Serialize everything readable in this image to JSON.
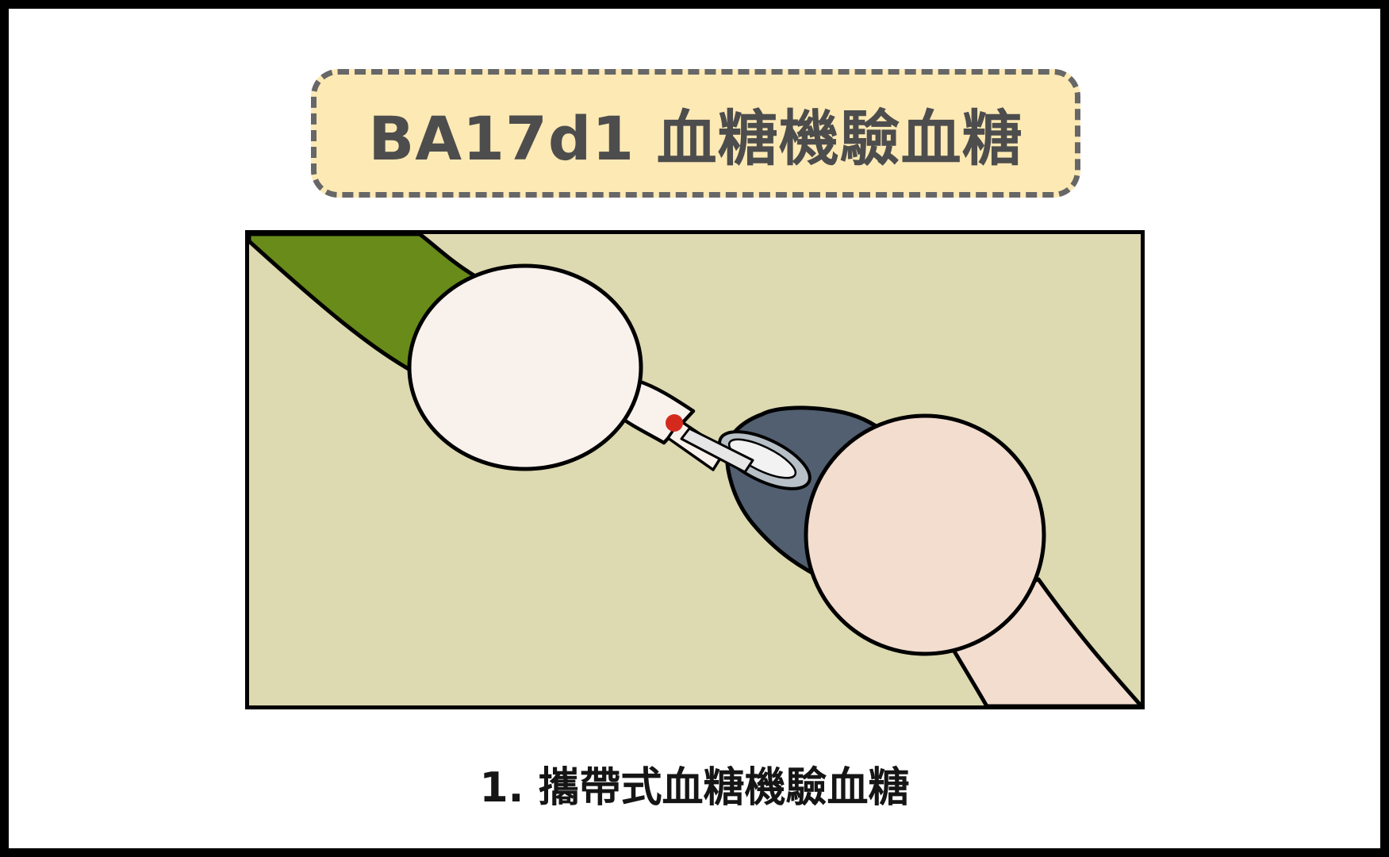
{
  "title": "BA17d1 血糖機驗血糖",
  "caption": "1. 攜帶式血糖機驗血糖",
  "illustration": {
    "icons": [
      "finger-hand",
      "blood-drop",
      "glucose-meter-lancet",
      "hand-holding-device"
    ],
    "colors": {
      "background": "#ddd9b0",
      "sleeve": "#688b1a",
      "finger": "#f9f1ec",
      "device": "#515f70",
      "hand": "#f2ddcf",
      "blood": "#d42a1e",
      "title_fill": "#fde9b4",
      "title_border": "#676767"
    }
  }
}
